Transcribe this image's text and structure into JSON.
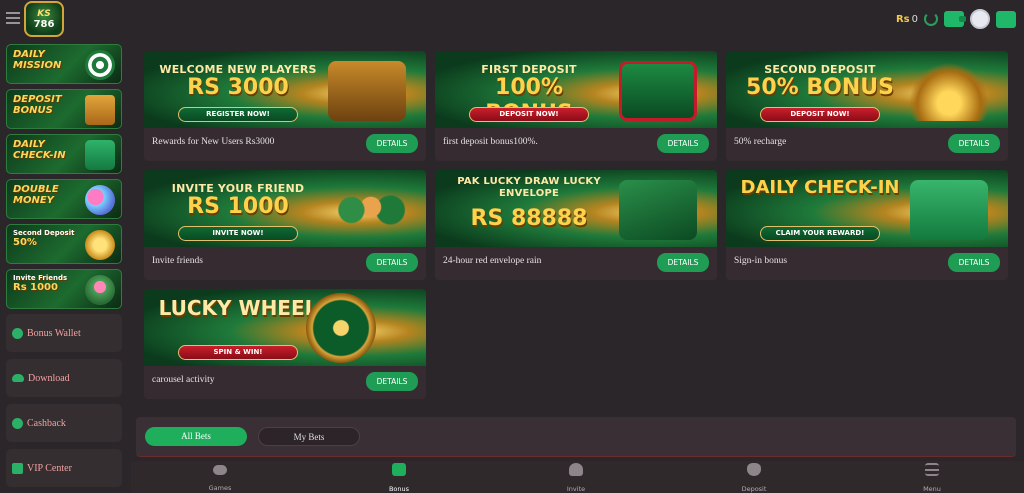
{
  "header": {
    "logo_top": "KS",
    "logo_bottom": "786",
    "currency": "Rs",
    "balance": "0"
  },
  "sidebar": {
    "promos": [
      {
        "title": "Daily Mission",
        "icon": "target-icon"
      },
      {
        "title": "Deposit Bonus",
        "icon": "giftbox-icon"
      },
      {
        "title": "Daily Check-in",
        "icon": "calendar-icon"
      },
      {
        "title": "Double Money",
        "icon": "kids-icon"
      },
      {
        "title": "Second Deposit",
        "subtitle": "50%",
        "icon": "coin-icon"
      },
      {
        "title": "Invite Friends",
        "subtitle": "Rs 1000",
        "icon": "friends-icon"
      }
    ],
    "links": [
      {
        "label": "Bonus Wallet",
        "icon": "wallet-icon"
      },
      {
        "label": "Download",
        "icon": "cloud-icon"
      },
      {
        "label": "Cashback",
        "icon": "dollar-icon"
      },
      {
        "label": "VIP Center",
        "icon": "crown-icon"
      }
    ]
  },
  "cards": [
    {
      "banner_title": "Welcome New Players",
      "banner_big": "Rs 3000",
      "banner_cta": "REGISTER NOW!",
      "art": "chest-art",
      "label": "Rewards for New Users Rs3000",
      "button": "DETAILS"
    },
    {
      "banner_title": "First Deposit",
      "banner_big": "100% Bonus",
      "banner_cta": "DEPOSIT NOW!",
      "art": "gift-art",
      "label": "first deposit bonus100%.",
      "button": "DETAILS"
    },
    {
      "banner_title": "Second Deposit",
      "banner_big": "50% Bonus",
      "banner_cta": "DEPOSIT NOW!",
      "art": "coins-art",
      "label": "50% recharge",
      "button": "DETAILS"
    },
    {
      "banner_title": "Invite Your Friend",
      "banner_big": "Rs 1000",
      "banner_cta": "INVITE NOW!",
      "art": "people-art",
      "label": "Invite friends",
      "button": "DETAILS"
    },
    {
      "banner_title": "Pak Lucky Draw Lucky Envelope",
      "banner_big": "Rs 88888",
      "banner_cta": "",
      "art": "envelope-art",
      "label": "24-hour red envelope rain",
      "button": "DETAILS"
    },
    {
      "banner_title": "Daily Check-in",
      "banner_big": "",
      "banner_cta": "CLAIM YOUR REWARD!",
      "art": "calendar-art",
      "label": "Sign-in bonus",
      "button": "DETAILS"
    },
    {
      "banner_title": "",
      "banner_big": "Lucky Wheel",
      "banner_cta": "SPIN & WIN!",
      "art": "wheel-art",
      "label": "carousel activity",
      "button": "DETAILS"
    }
  ],
  "bets": {
    "tabs": [
      "All Bets",
      "My Bets"
    ]
  },
  "bottom_nav": [
    {
      "label": "Games",
      "icon": "gamepad-icon",
      "active": false
    },
    {
      "label": "Bonus",
      "icon": "gift-icon",
      "active": true
    },
    {
      "label": "Invite",
      "icon": "people-icon",
      "active": false
    },
    {
      "label": "Deposit",
      "icon": "moneybag-icon",
      "active": false
    },
    {
      "label": "Menu",
      "icon": "hamburger-icon",
      "active": false
    }
  ]
}
